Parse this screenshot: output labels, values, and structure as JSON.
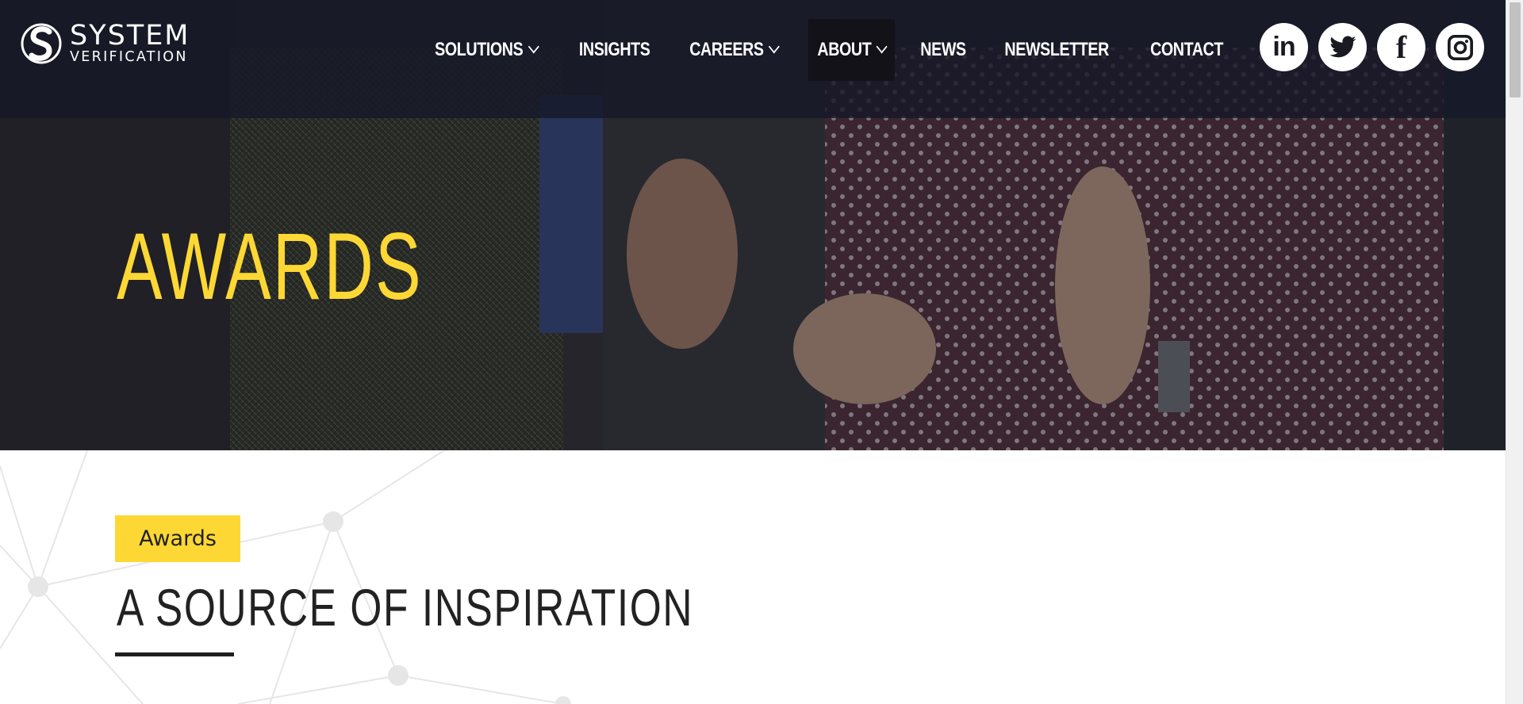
{
  "logo": {
    "line1": "SYSTEM",
    "line2": "VERIFICATION",
    "icon": "s-logo-icon"
  },
  "nav": {
    "items": [
      {
        "label": "SOLUTIONS",
        "dropdown": true
      },
      {
        "label": "INSIGHTS",
        "dropdown": false
      },
      {
        "label": "CAREERS",
        "dropdown": true
      },
      {
        "label": "ABOUT",
        "dropdown": true,
        "active": true
      },
      {
        "label": "NEWS",
        "dropdown": false
      },
      {
        "label": "NEWSLETTER",
        "dropdown": false
      },
      {
        "label": "CONTACT",
        "dropdown": false
      }
    ]
  },
  "social": {
    "linkedin": "in",
    "twitter": "twitter-icon",
    "facebook": "f",
    "instagram": "instagram-icon"
  },
  "hero": {
    "title": "AWARDS"
  },
  "section": {
    "tag": "Awards",
    "title": "A SOURCE OF INSPIRATION"
  },
  "colors": {
    "accent": "#fdd835",
    "header": "#161828",
    "text": "#222222"
  }
}
